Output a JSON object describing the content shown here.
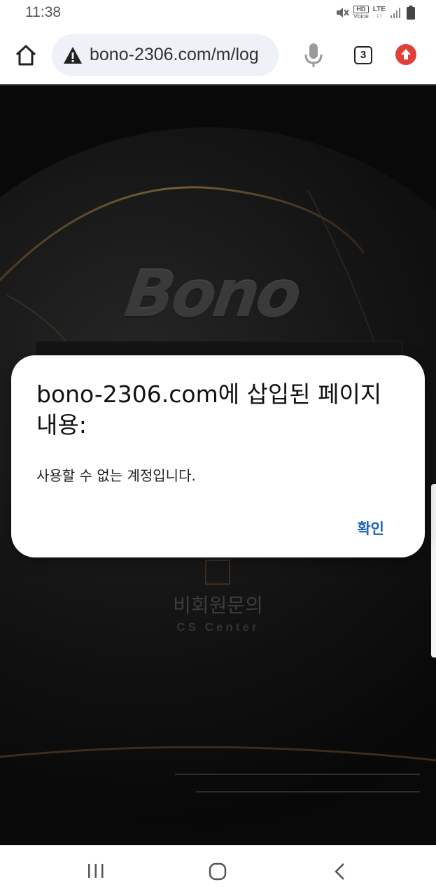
{
  "status_bar": {
    "time": "11:38",
    "hd_label": "HD",
    "voice_label": "Voice",
    "network_label": "LTE",
    "icons": [
      "mute-icon",
      "hd-voice-icon",
      "lte-icon",
      "signal-icon",
      "battery-icon"
    ]
  },
  "browser": {
    "url": "bono-2306.com/m/log",
    "tab_count": "3",
    "icons": [
      "home-icon",
      "warning-icon",
      "mic-icon",
      "tabs-icon",
      "update-icon"
    ]
  },
  "page": {
    "logo_text": "Bono",
    "cs_label": "비회원문의",
    "cs_sub": "CS Center"
  },
  "dialog": {
    "title": "bono-2306.com에 삽입된 페이지 내용:",
    "message": "사용할 수 없는 계정입니다.",
    "ok_label": "확인",
    "ok_color": "#1d63b8"
  },
  "nav": {
    "icons": [
      "recent-apps-icon",
      "home-nav-icon",
      "back-icon"
    ]
  }
}
